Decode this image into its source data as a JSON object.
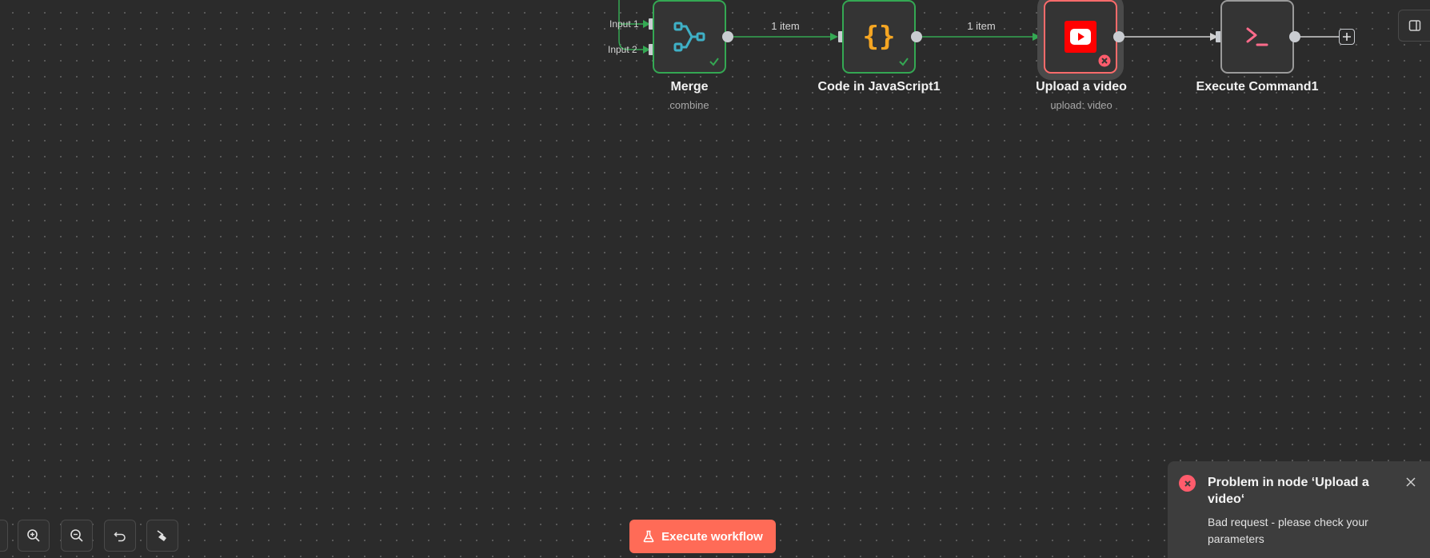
{
  "canvas": {
    "nodes": {
      "merge": {
        "title": "Merge",
        "subtitle": "combine",
        "status": "success",
        "icon": "merge-icon"
      },
      "code": {
        "title": "Code in JavaScript1",
        "subtitle": "",
        "status": "success",
        "icon": "code-braces-icon"
      },
      "upload": {
        "title": "Upload a video",
        "subtitle": "upload: video",
        "status": "error",
        "icon": "youtube-icon"
      },
      "execute_command": {
        "title": "Execute Command1",
        "subtitle": "",
        "status": "idle",
        "icon": "terminal-icon"
      }
    },
    "merge_inputs": {
      "input1": "Input 1",
      "input2": "Input 2"
    },
    "edges": {
      "merge_to_code": "1 item",
      "code_to_upload": "1 item"
    }
  },
  "toolbar": {
    "zoom_in": "zoom-in-icon",
    "zoom_out": "zoom-out-icon",
    "undo": "undo-icon",
    "tidy": "broom-icon",
    "execute_label": "Execute workflow"
  },
  "toast": {
    "title": "Problem in node ‘Upload a video‘",
    "message": "Bad request - please check your parameters"
  },
  "colors": {
    "canvas_bg": "#2b2b2b",
    "success": "#34a853",
    "error": "#ff6b6b",
    "execute_button": "#ff6b57",
    "youtube_red": "#ff0000"
  }
}
